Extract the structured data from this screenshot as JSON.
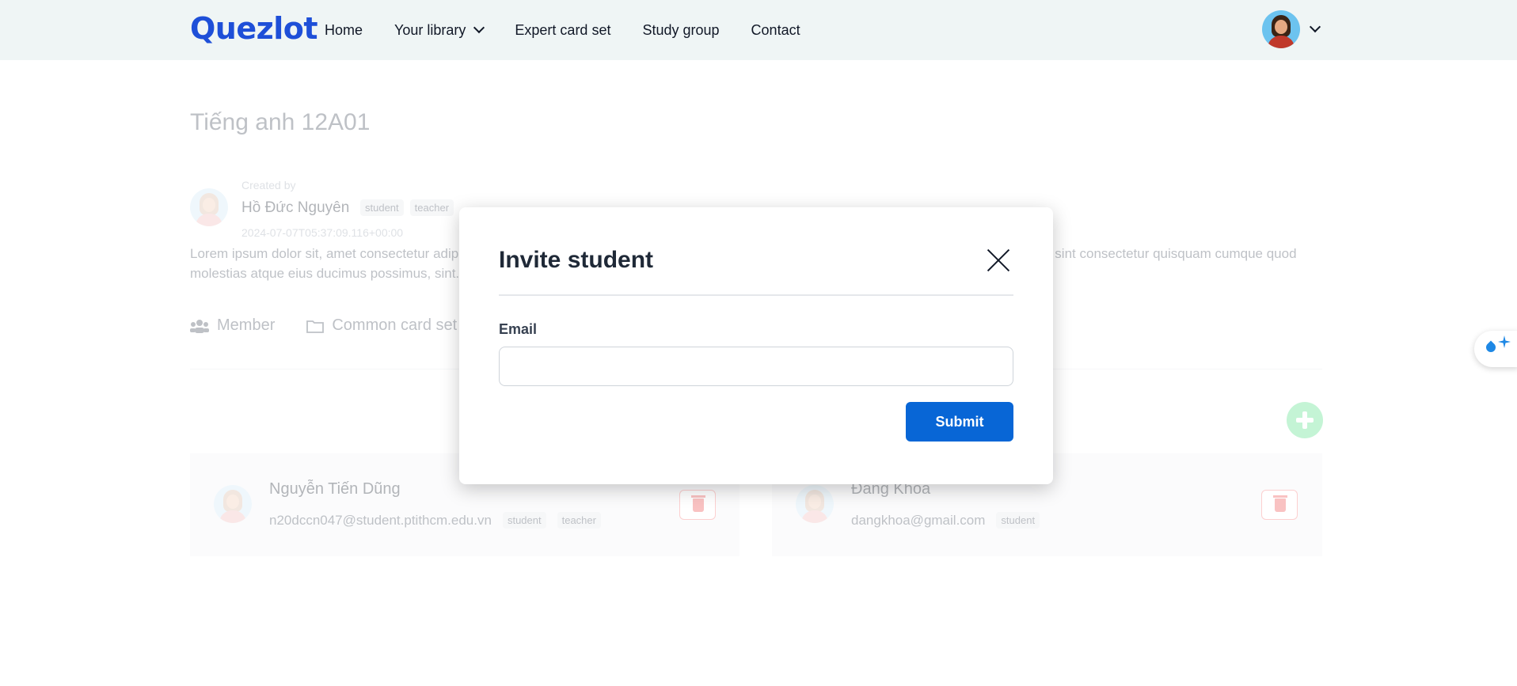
{
  "header": {
    "logo": "Quezlot",
    "nav": [
      {
        "label": "Home"
      },
      {
        "label": "Your library"
      },
      {
        "label": "Expert card set"
      },
      {
        "label": "Study group"
      },
      {
        "label": "Contact"
      }
    ]
  },
  "group": {
    "title": "Tiếng anh 12A01",
    "created_by_label": "Created by",
    "creator_name": "Hồ Đức Nguyên",
    "creator_roles": [
      "student",
      "teacher"
    ],
    "created_at": "2024-07-07T05:37:09.116+00:00",
    "description": "Lorem ipsum dolor sit, amet consectetur adipisicing elit. Quisquam consectetur quisquam cumque quod molestias atque eius ducimus possimus, sint consectetur quisquam cumque quod molestias atque eius ducimus possimus, sint."
  },
  "tabs": [
    {
      "label": "Member",
      "icon": "users-icon"
    },
    {
      "label": "Common card set",
      "icon": "folder-icon"
    }
  ],
  "members": [
    {
      "name": "Nguyễn Tiến Dũng",
      "email": "n20dccn047@student.ptithcm.edu.vn",
      "roles": [
        "student",
        "teacher"
      ]
    },
    {
      "name": "Đang Khoa",
      "email": "dangkhoa@gmail.com",
      "roles": [
        "student"
      ]
    }
  ],
  "modal": {
    "title": "Invite student",
    "email_label": "Email",
    "email_value": "",
    "email_placeholder": "",
    "submit_label": "Submit"
  },
  "colors": {
    "brand": "#1e4fd8",
    "primary_button": "#0866d6",
    "header_bg": "#eff5f5",
    "add_button": "#4ade80",
    "danger": "#ef4444"
  }
}
